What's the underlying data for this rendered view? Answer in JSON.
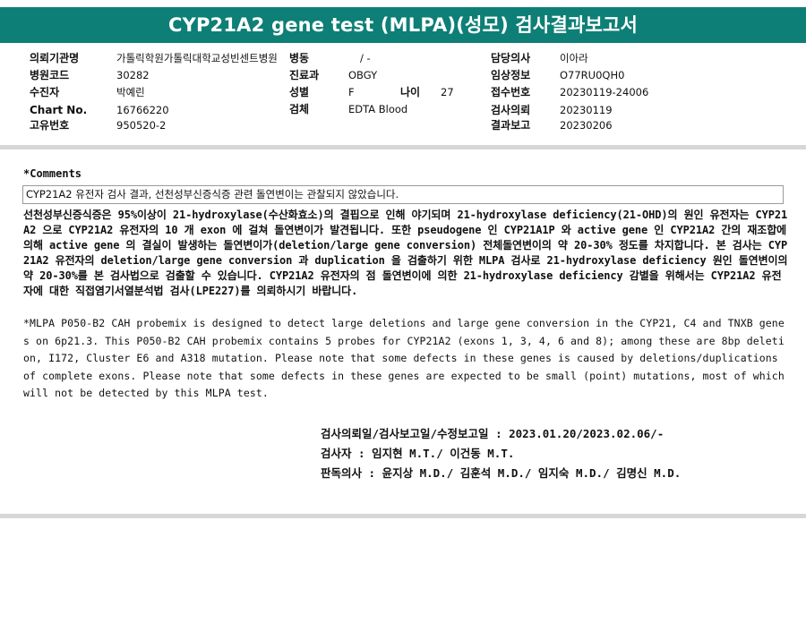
{
  "title": "CYP21A2 gene test (MLPA)(성모) 검사결과보고서",
  "info": {
    "hospital_label": "의뢰기관명",
    "hospital_value": "가톨릭학원가톨릭대학교성빈센트병원",
    "ward_label": "병동",
    "ward_value": "/ -",
    "doctor_label": "담당의사",
    "doctor_value": "이아라",
    "code_label": "병원코드",
    "code_value": "30282",
    "dept_label": "진료과",
    "dept_value": "OBGY",
    "clinical_label": "임상정보",
    "clinical_value": "O77RU0QH0",
    "patient_label": "수진자",
    "patient_value": "박예린",
    "sex_label": "성별",
    "sex_value": "F",
    "age_label": "나이",
    "age_value": "27",
    "reception_label": "접수번호",
    "reception_value": "20230119-24006",
    "chart_label": "Chart No.",
    "chart_value": "16766220",
    "specimen_label": "검체",
    "specimen_value": "EDTA Blood",
    "request_label": "검사의뢰",
    "request_value": "20230119",
    "unique_label": "고유번호",
    "unique_value": "950520-2",
    "report_label": "결과보고",
    "report_value": "20230206"
  },
  "comments": {
    "label": "*Comments",
    "result": "CYP21A2 유전자 검사 결과, 선천성부신증식증 관련 돌연변이는 관찰되지 않았습니다.",
    "explanation": "선천성부신증식증은 95%이상이 21-hydroxylase(수산화효소)의 결핍으로 인해 야기되며 21-hydroxylase deficiency(21-OHD)의 원인 유전자는 CYP21A2 으로 CYP21A2 유전자의 10 개 exon 에 걸쳐 돌연변이가 발견됩니다. 또한 pseudogene 인 CYP21A1P 와 active gene 인 CYP21A2 간의 재조합에 의해 active gene 의 결실이 발생하는 돌연변이가(deletion/large gene conversion) 전체돌연변이의 약 20-30% 정도를 차지합니다. 본 검사는 CYP21A2 유전자의 deletion/large gene conversion 과 duplication 을 검출하기 위한 MLPA 검사로 21-hydroxylase deficiency 원인 돌연변이의 약 20-30%를 본 검사법으로 검출할 수 있습니다. CYP21A2 유전자의 점 돌연변이에 의한 21-hydroxylase deficiency 감별을 위해서는 CYP21A2 유전자에 대한 직접염기서열분석법 검사(LPE227)를 의뢰하시기 바랍니다.",
    "note": "*MLPA P050-B2 CAH probemix is designed to detect large deletions and large gene conversion in the CYP21, C4 and TNXB genes on 6p21.3. This P050-B2 CAH probemix contains 5 probes for CYP21A2 (exons 1, 3, 4, 6 and 8); among these are 8bp deletion, I172, Cluster E6 and A318 mutation. Please note that some defects in these genes is caused by deletions/duplications of complete exons. Please note that some defects in these genes are expected to be small (point) mutations, most of which will not be detected by this MLPA test."
  },
  "signature": {
    "dates": "검사의뢰일/검사보고일/수정보고일 : 2023.01.20/2023.02.06/-",
    "testers": "검사자 : 임지현 M.T./ 이건동 M.T.",
    "readers": "판독의사 : 윤지상 M.D./ 김훈석 M.D./ 임지숙 M.D./ 김명신 M.D."
  }
}
